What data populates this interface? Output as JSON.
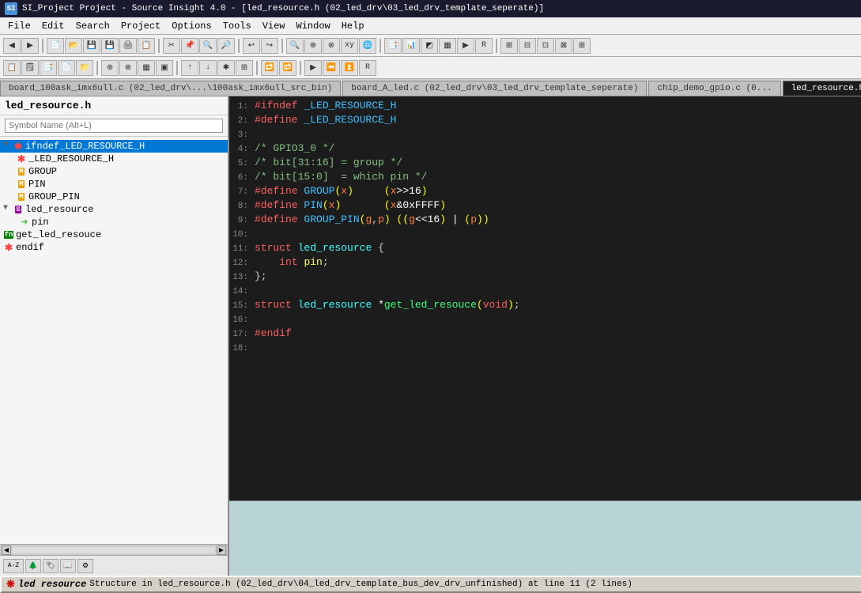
{
  "titleBar": {
    "icon": "SI",
    "title": "SI_Project Project - Source Insight 4.0 - [led_resource.h (02_led_drv\\03_led_drv_template_seperate)]"
  },
  "menuBar": {
    "items": [
      "File",
      "Edit",
      "Search",
      "Project",
      "Options",
      "Tools",
      "View",
      "Window",
      "Help"
    ]
  },
  "tabs": [
    {
      "label": "board_100ask_imx6ull.c (02_led_drv\\...\\100ask_imx6ull_src_bin)",
      "active": false
    },
    {
      "label": "board_A_led.c (02_led_drv\\03_led_drv_template_seperate)",
      "active": false
    },
    {
      "label": "chip_demo_gpio.c (0...",
      "active": false
    },
    {
      "label": "led_resource.h",
      "active": true
    }
  ],
  "leftPanel": {
    "fileTitle": "led_resource.h",
    "symbolSearch": {
      "placeholder": "Symbol Name (Alt+L)"
    },
    "treeItems": [
      {
        "id": "ifndef_LED_RESOURCE_H",
        "label": "ifndef_LED_RESOURCE_H",
        "type": "define",
        "indent": 0,
        "expanded": true,
        "selected": true
      },
      {
        "id": "_LED_RESOURCE_H",
        "label": "_LED_RESOURCE_H",
        "type": "define",
        "indent": 1,
        "selected": false
      },
      {
        "id": "GROUP",
        "label": "GROUP",
        "type": "macro",
        "indent": 1,
        "selected": false
      },
      {
        "id": "PIN",
        "label": "PIN",
        "type": "macro",
        "indent": 1,
        "selected": false
      },
      {
        "id": "GROUP_PIN",
        "label": "GROUP_PIN",
        "type": "macro",
        "indent": 1,
        "selected": false
      },
      {
        "id": "led_resource",
        "label": "led_resource",
        "type": "struct",
        "indent": 0,
        "expanded": true,
        "selected": false
      },
      {
        "id": "pin",
        "label": "pin",
        "type": "field",
        "indent": 1,
        "selected": false
      },
      {
        "id": "get_led_resouce",
        "label": "get_led_resouce",
        "type": "func",
        "indent": 0,
        "selected": false
      },
      {
        "id": "endif",
        "label": "endif",
        "type": "define",
        "indent": 0,
        "selected": false
      }
    ]
  },
  "codeLines": [
    {
      "num": 1,
      "content": "#ifndef _LED_RESOURCE_H"
    },
    {
      "num": 2,
      "content": "#define _LED_RESOURCE_H"
    },
    {
      "num": 3,
      "content": ""
    },
    {
      "num": 4,
      "content": "/* GPIO3_0 */"
    },
    {
      "num": 5,
      "content": "/* bit[31:16] = group */"
    },
    {
      "num": 6,
      "content": "/* bit[15:0]  = which pin */"
    },
    {
      "num": 7,
      "content": "#define GROUP(x)     (x>>16)"
    },
    {
      "num": 8,
      "content": "#define PIN(x)       (x&0xFFFF)"
    },
    {
      "num": 9,
      "content": "#define GROUP_PIN(g,p) ((g<<16) | (p))"
    },
    {
      "num": 10,
      "content": ""
    },
    {
      "num": 11,
      "content": "struct led_resource {"
    },
    {
      "num": 12,
      "content": "    int pin;"
    },
    {
      "num": 13,
      "content": "};"
    },
    {
      "num": 14,
      "content": ""
    },
    {
      "num": 15,
      "content": "struct led_resource *get_led_resouce(void);"
    },
    {
      "num": 16,
      "content": ""
    },
    {
      "num": 17,
      "content": "#endif"
    },
    {
      "num": 18,
      "content": ""
    }
  ],
  "statusBar": {
    "icon": "led_resource",
    "text": "Structure in led_resource.h (02_led_drv\\04_led_drv_template_bus_dev_drv_unfinished) at line 11 (2 lines)"
  },
  "bottomToolbar": {
    "buttons": [
      "A-Z",
      "tree",
      "tag",
      "book",
      "gear"
    ]
  }
}
